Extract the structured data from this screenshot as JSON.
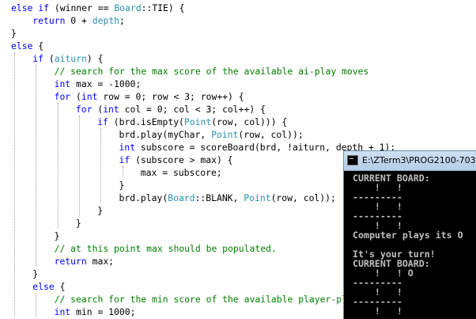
{
  "editor": {
    "lines": [
      {
        "indent": 0,
        "tokens": [
          {
            "t": "else",
            "c": "kw"
          },
          {
            "t": " "
          },
          {
            "t": "if",
            "c": "kw"
          },
          {
            "t": " (winner == "
          },
          {
            "t": "Board",
            "c": "ty"
          },
          {
            "t": "::TIE) {"
          }
        ]
      },
      {
        "indent": 1,
        "tokens": [
          {
            "t": "return",
            "c": "kw"
          },
          {
            "t": " 0 + "
          },
          {
            "t": "depth",
            "c": "ty"
          },
          {
            "t": ";"
          }
        ]
      },
      {
        "indent": 0,
        "tokens": [
          {
            "t": "}"
          }
        ]
      },
      {
        "indent": 0,
        "tokens": [
          {
            "t": "else",
            "c": "kw"
          },
          {
            "t": " {"
          }
        ]
      },
      {
        "indent": 1,
        "tokens": [
          {
            "t": "if",
            "c": "kw"
          },
          {
            "t": " ("
          },
          {
            "t": "aiturn",
            "c": "ty"
          },
          {
            "t": ") {"
          }
        ]
      },
      {
        "indent": 2,
        "tokens": [
          {
            "t": "// search for the max score of the available ai-play moves",
            "c": "cm"
          }
        ]
      },
      {
        "indent": 2,
        "tokens": [
          {
            "t": "int",
            "c": "kw"
          },
          {
            "t": " max = -1000;"
          }
        ]
      },
      {
        "indent": 2,
        "tokens": [
          {
            "t": "for",
            "c": "kw"
          },
          {
            "t": " ("
          },
          {
            "t": "int",
            "c": "kw"
          },
          {
            "t": " row = 0; row < 3; row++) {"
          }
        ]
      },
      {
        "indent": 3,
        "tokens": [
          {
            "t": "for",
            "c": "kw"
          },
          {
            "t": " ("
          },
          {
            "t": "int",
            "c": "kw"
          },
          {
            "t": " col = 0; col < 3; col++) {"
          }
        ]
      },
      {
        "indent": 4,
        "tokens": [
          {
            "t": "if",
            "c": "kw"
          },
          {
            "t": " (brd.isEmpty("
          },
          {
            "t": "Point",
            "c": "ty"
          },
          {
            "t": "(row, col))) {"
          }
        ]
      },
      {
        "indent": 5,
        "tokens": [
          {
            "t": "brd.play(myChar, "
          },
          {
            "t": "Point",
            "c": "ty"
          },
          {
            "t": "(row, col));"
          }
        ]
      },
      {
        "indent": 5,
        "tokens": [
          {
            "t": "int",
            "c": "kw"
          },
          {
            "t": " subscore = scoreBoard(brd, !aiturn, depth + 1);"
          }
        ]
      },
      {
        "indent": 5,
        "tokens": [
          {
            "t": "if",
            "c": "kw"
          },
          {
            "t": " (subscore > max) {"
          }
        ]
      },
      {
        "indent": 6,
        "tokens": [
          {
            "t": "max = subscore;"
          }
        ]
      },
      {
        "indent": 5,
        "tokens": [
          {
            "t": "}"
          }
        ]
      },
      {
        "indent": 5,
        "tokens": [
          {
            "t": "brd.play("
          },
          {
            "t": "Board",
            "c": "ty"
          },
          {
            "t": "::BLANK, "
          },
          {
            "t": "Point",
            "c": "ty"
          },
          {
            "t": "(row, col));"
          }
        ]
      },
      {
        "indent": 4,
        "tokens": [
          {
            "t": "}"
          }
        ]
      },
      {
        "indent": 3,
        "tokens": [
          {
            "t": "}"
          }
        ]
      },
      {
        "indent": 2,
        "tokens": [
          {
            "t": "}"
          }
        ]
      },
      {
        "indent": 2,
        "tokens": [
          {
            "t": "// at this point max should be populated.",
            "c": "cm"
          }
        ]
      },
      {
        "indent": 2,
        "tokens": [
          {
            "t": "return",
            "c": "kw"
          },
          {
            "t": " max;"
          }
        ]
      },
      {
        "indent": 1,
        "tokens": [
          {
            "t": "}"
          }
        ]
      },
      {
        "indent": 1,
        "tokens": [
          {
            "t": "else",
            "c": "kw"
          },
          {
            "t": " {"
          }
        ]
      },
      {
        "indent": 2,
        "tokens": [
          {
            "t": "// search for the min score of the available player-play moves",
            "c": "cm"
          }
        ]
      },
      {
        "indent": 2,
        "tokens": [
          {
            "t": "int",
            "c": "kw"
          },
          {
            "t": " min = 1000;"
          }
        ]
      }
    ]
  },
  "console": {
    "title": "E:\\ZTerm3\\PROG2100-703",
    "lines": [
      "CURRENT BOARD:",
      "    !   !",
      "---------",
      "    !   !",
      "---------",
      "    !   !",
      "Computer plays its O",
      "",
      "It's your turn!",
      "CURRENT BOARD:",
      "    !   ! O",
      "---------",
      "    !   !",
      "---------",
      "    !   !"
    ]
  },
  "colors": {
    "keyword": "#0000ff",
    "type": "#2b91af",
    "comment": "#008000",
    "console_bg": "#000000",
    "console_text": "#c0c0c0"
  }
}
